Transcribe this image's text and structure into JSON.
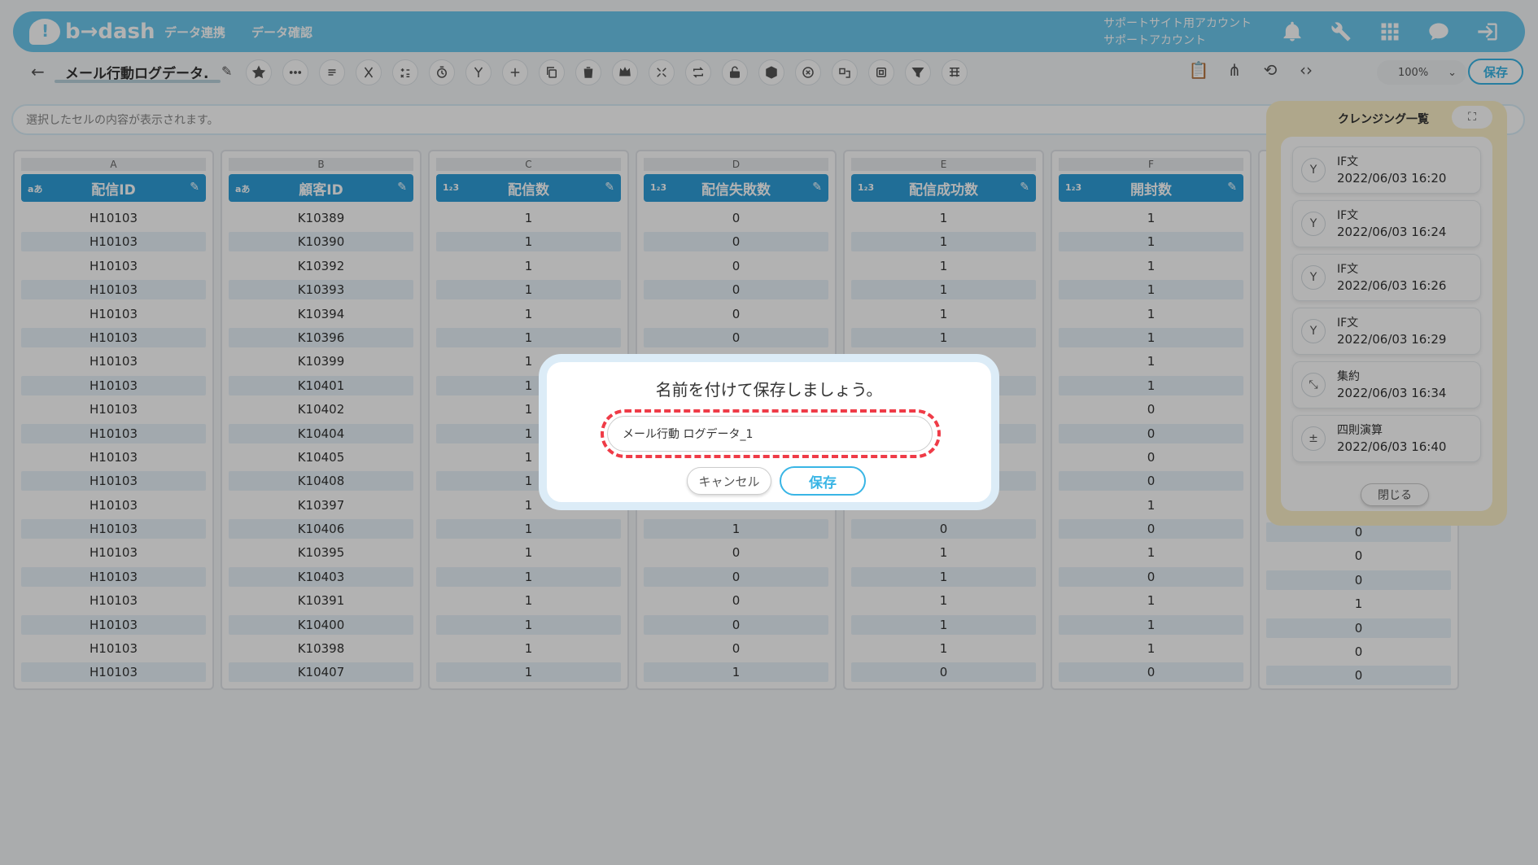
{
  "brand": {
    "logo_mark": "!",
    "logo_text": "b→dash",
    "color": "#6cc7ec"
  },
  "nav": {
    "items": [
      "データ連携",
      "データ確認"
    ]
  },
  "account": {
    "line1": "サポートサイト用アカウント",
    "line2": "サポートアカウント"
  },
  "topbar_icons": [
    "bell-icon",
    "wrench-icon",
    "grid-icon",
    "chat-icon",
    "logout-icon"
  ],
  "toolbar": {
    "back_label": "←",
    "file_title": "メール行動ログデータ.",
    "edit_icon": "✎",
    "tools": [
      "star-icon",
      "more-icon",
      "list-icon",
      "cut-icon",
      "calc-icon",
      "timer-icon",
      "branch-icon",
      "plus-icon",
      "copy-icon",
      "trash-icon",
      "crown-icon",
      "shrink-icon",
      "repeat-icon",
      "unlock-icon",
      "box-icon",
      "cancel-icon",
      "transform-icon",
      "frame-icon",
      "filter-icon",
      "table-icon"
    ],
    "right_icons": [
      "clipboard-icon",
      "share-icon",
      "history-icon",
      "code-icon"
    ],
    "zoom": "100%",
    "save_label": "保存"
  },
  "cellbar": {
    "placeholder": "選択したセルの内容が表示されます。"
  },
  "columns": [
    {
      "letter": "A",
      "type": "aあ",
      "name": "配信ID",
      "cells": [
        "H10103",
        "H10103",
        "H10103",
        "H10103",
        "H10103",
        "H10103",
        "H10103",
        "H10103",
        "H10103",
        "H10103",
        "H10103",
        "H10103",
        "H10103",
        "H10103",
        "H10103",
        "H10103",
        "H10103",
        "H10103",
        "H10103",
        "H10103"
      ]
    },
    {
      "letter": "B",
      "type": "aあ",
      "name": "顧客ID",
      "cells": [
        "K10389",
        "K10390",
        "K10392",
        "K10393",
        "K10394",
        "K10396",
        "K10399",
        "K10401",
        "K10402",
        "K10404",
        "K10405",
        "K10408",
        "K10397",
        "K10406",
        "K10395",
        "K10403",
        "K10391",
        "K10400",
        "K10398",
        "K10407"
      ]
    },
    {
      "letter": "C",
      "type": "1₂3",
      "name": "配信数",
      "cells": [
        "1",
        "1",
        "1",
        "1",
        "1",
        "1",
        "1",
        "1",
        "1",
        "1",
        "1",
        "1",
        "1",
        "1",
        "1",
        "1",
        "1",
        "1",
        "1",
        "1"
      ]
    },
    {
      "letter": "D",
      "type": "1₂3",
      "name": "配信失敗数",
      "cells": [
        "0",
        "0",
        "0",
        "0",
        "0",
        "0",
        "",
        "",
        "",
        "",
        "",
        "",
        "",
        "1",
        "0",
        "0",
        "0",
        "0",
        "0",
        "1"
      ]
    },
    {
      "letter": "E",
      "type": "1₂3",
      "name": "配信成功数",
      "cells": [
        "1",
        "1",
        "1",
        "1",
        "1",
        "1",
        "",
        "",
        "",
        "",
        "",
        "",
        "",
        "0",
        "1",
        "1",
        "1",
        "1",
        "1",
        "0"
      ]
    },
    {
      "letter": "F",
      "type": "1₂3",
      "name": "開封数",
      "cells": [
        "1",
        "1",
        "1",
        "1",
        "1",
        "1",
        "1",
        "1",
        "0",
        "0",
        "0",
        "0",
        "1",
        "0",
        "1",
        "0",
        "1",
        "1",
        "1",
        "0"
      ]
    }
  ],
  "partial_column": {
    "cells": [
      "",
      "",
      "",
      "",
      "",
      "",
      "",
      "",
      "",
      "",
      "",
      "",
      "",
      "0",
      "0",
      "0",
      "1",
      "0",
      "0",
      "0"
    ]
  },
  "cleansing": {
    "title": "クレンジング一覧",
    "expand_icon": "⛶",
    "items": [
      {
        "icon": "branch-icon",
        "glyph": "Y",
        "name": "IF文",
        "date": "2022/06/03 16:20"
      },
      {
        "icon": "branch-icon",
        "glyph": "Y",
        "name": "IF文",
        "date": "2022/06/03 16:24"
      },
      {
        "icon": "branch-icon",
        "glyph": "Y",
        "name": "IF文",
        "date": "2022/06/03 16:26"
      },
      {
        "icon": "branch-icon",
        "glyph": "Y",
        "name": "IF文",
        "date": "2022/06/03 16:29"
      },
      {
        "icon": "shrink-icon",
        "glyph": "⤡",
        "name": "集約",
        "date": "2022/06/03 16:34"
      },
      {
        "icon": "calc-icon",
        "glyph": "±",
        "name": "四則演算",
        "date": "2022/06/03 16:40"
      }
    ],
    "close_label": "閉じる"
  },
  "dialog": {
    "title": "名前を付けて保存しましょう。",
    "input_value": "メール行動 ログデータ_1",
    "cancel_label": "キャンセル",
    "save_label": "保存",
    "highlight_color": "#ef3b47"
  }
}
